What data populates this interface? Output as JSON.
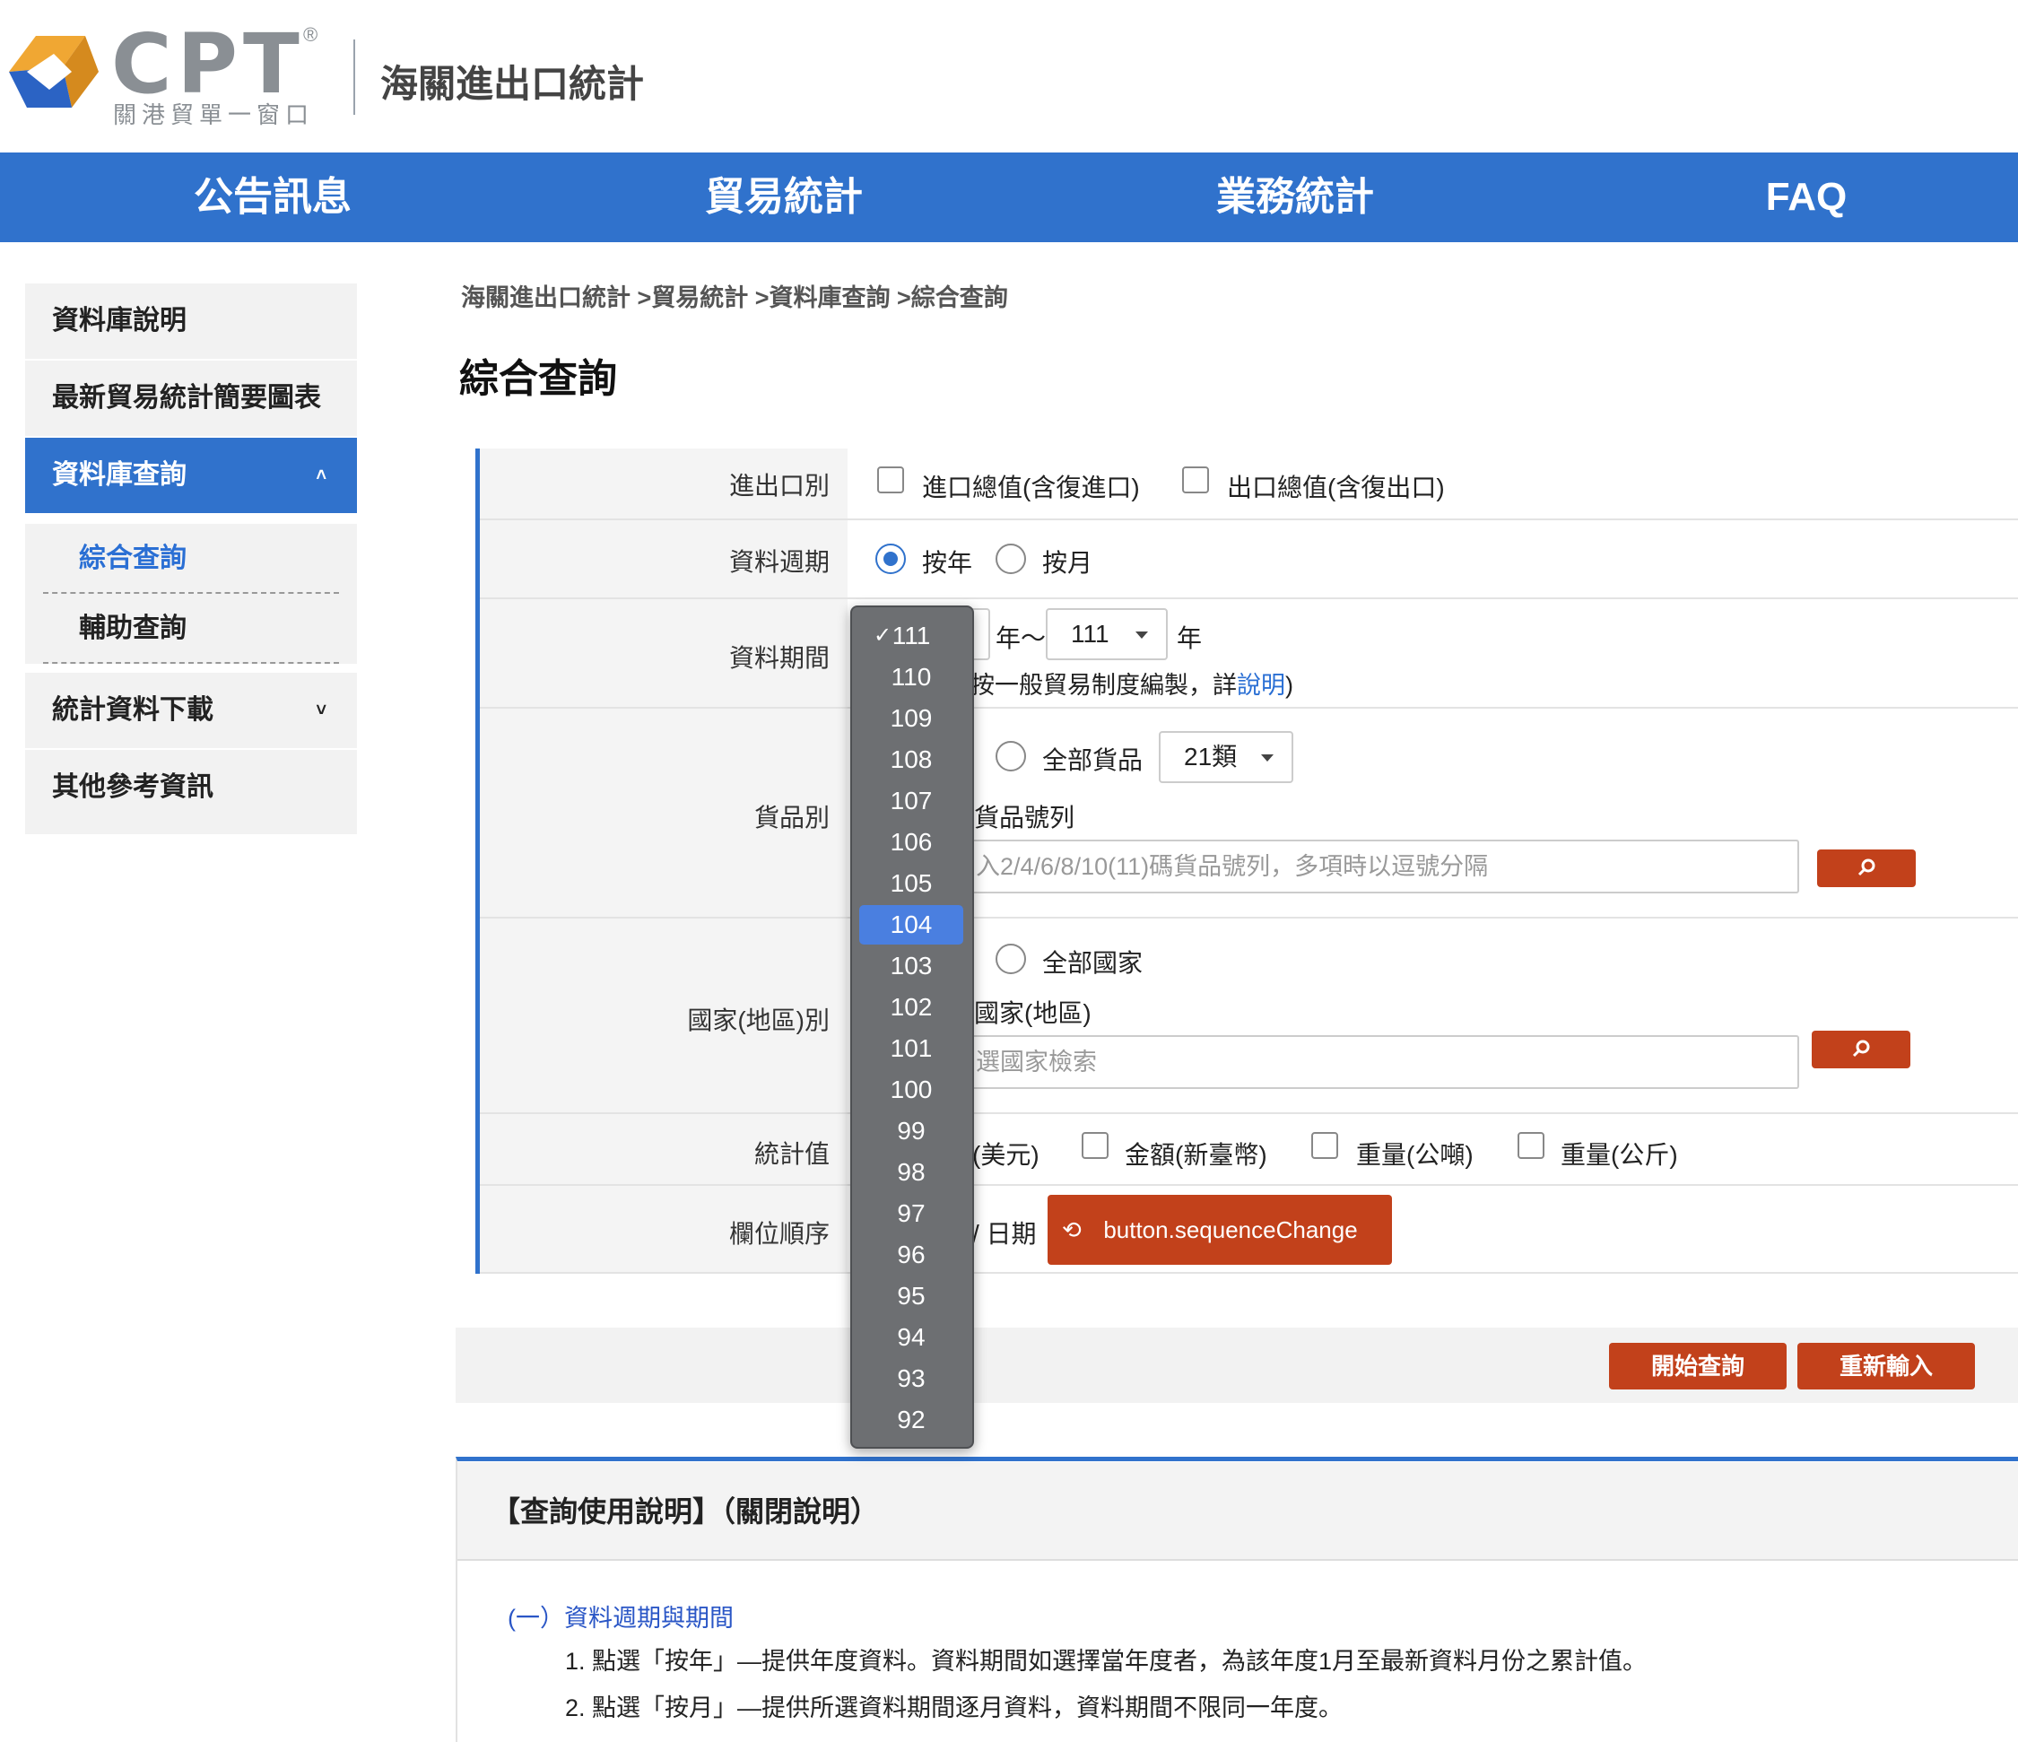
{
  "header": {
    "logo_text": "CPT",
    "logo_reg": "®",
    "logo_sub": "關港貿單一窗口",
    "site_title": "海關進出口統計"
  },
  "nav": [
    "公告訊息",
    "貿易統計",
    "業務統計",
    "FAQ"
  ],
  "sidebar": {
    "items": [
      "資料庫說明",
      "最新貿易統計簡要圖表",
      "資料庫查詢",
      "統計資料下載",
      "其他參考資訊"
    ],
    "sub_items": [
      "綜合查詢",
      "輔助查詢"
    ],
    "caret_up": "˄",
    "caret_down": "˅"
  },
  "breadcrumb": "海關進出口統計 >貿易統計 >資料庫查詢 >綜合查詢",
  "page_title": "綜合查詢",
  "form": {
    "labels": [
      "進出口別",
      "資料週期",
      "資料期間",
      "貨品別",
      "國家(地區)別",
      "統計值",
      "欄位順序"
    ],
    "trade_type": [
      "進口總值(含復進口)",
      "出口總值(含復出口)"
    ],
    "period_type": [
      "按年",
      "按月"
    ],
    "period": {
      "year_sep": "年～",
      "to_year": "111",
      "year_suffix": "年",
      "note_prefix": "按一般貿易制度編製，詳",
      "note_link": "說明",
      "note_suffix": ")"
    },
    "goods": {
      "all_label": "全部貨品",
      "class_select": "21類",
      "code_label": "貨品號列",
      "code_placeholder": "入2/4/6/8/10(11)碼貨品號列，多項時以逗號分隔"
    },
    "country": {
      "all_label": "全部國家",
      "pick_label": "國家(地區)",
      "search_placeholder": "選國家檢索"
    },
    "stat_values": [
      "(美元)",
      "金額(新臺幣)",
      "重量(公噸)",
      "重量(公斤)"
    ],
    "order": {
      "text": "/ 日期",
      "button": "button.sequenceChange"
    }
  },
  "actions": {
    "search": "開始查詢",
    "reset": "重新輸入"
  },
  "help": {
    "title": "【查詢使用說明】（關閉說明）",
    "section1_title": "(一）資料週期與期間",
    "lines": [
      "1. 點選「按年」—提供年度資料。資料期間如選擇當年度者，為該年度1月至最新資料月份之累計值。",
      "2. 點選「按月」—提供所選資料期間逐月資料，資料期間不限同一年度。"
    ]
  },
  "year_dropdown": {
    "selected": "111",
    "highlighted": "104",
    "check_mark": "✓",
    "options": [
      "111",
      "110",
      "109",
      "108",
      "107",
      "106",
      "105",
      "104",
      "103",
      "102",
      "101",
      "100",
      "99",
      "98",
      "97",
      "96",
      "95",
      "94",
      "93",
      "92"
    ]
  }
}
